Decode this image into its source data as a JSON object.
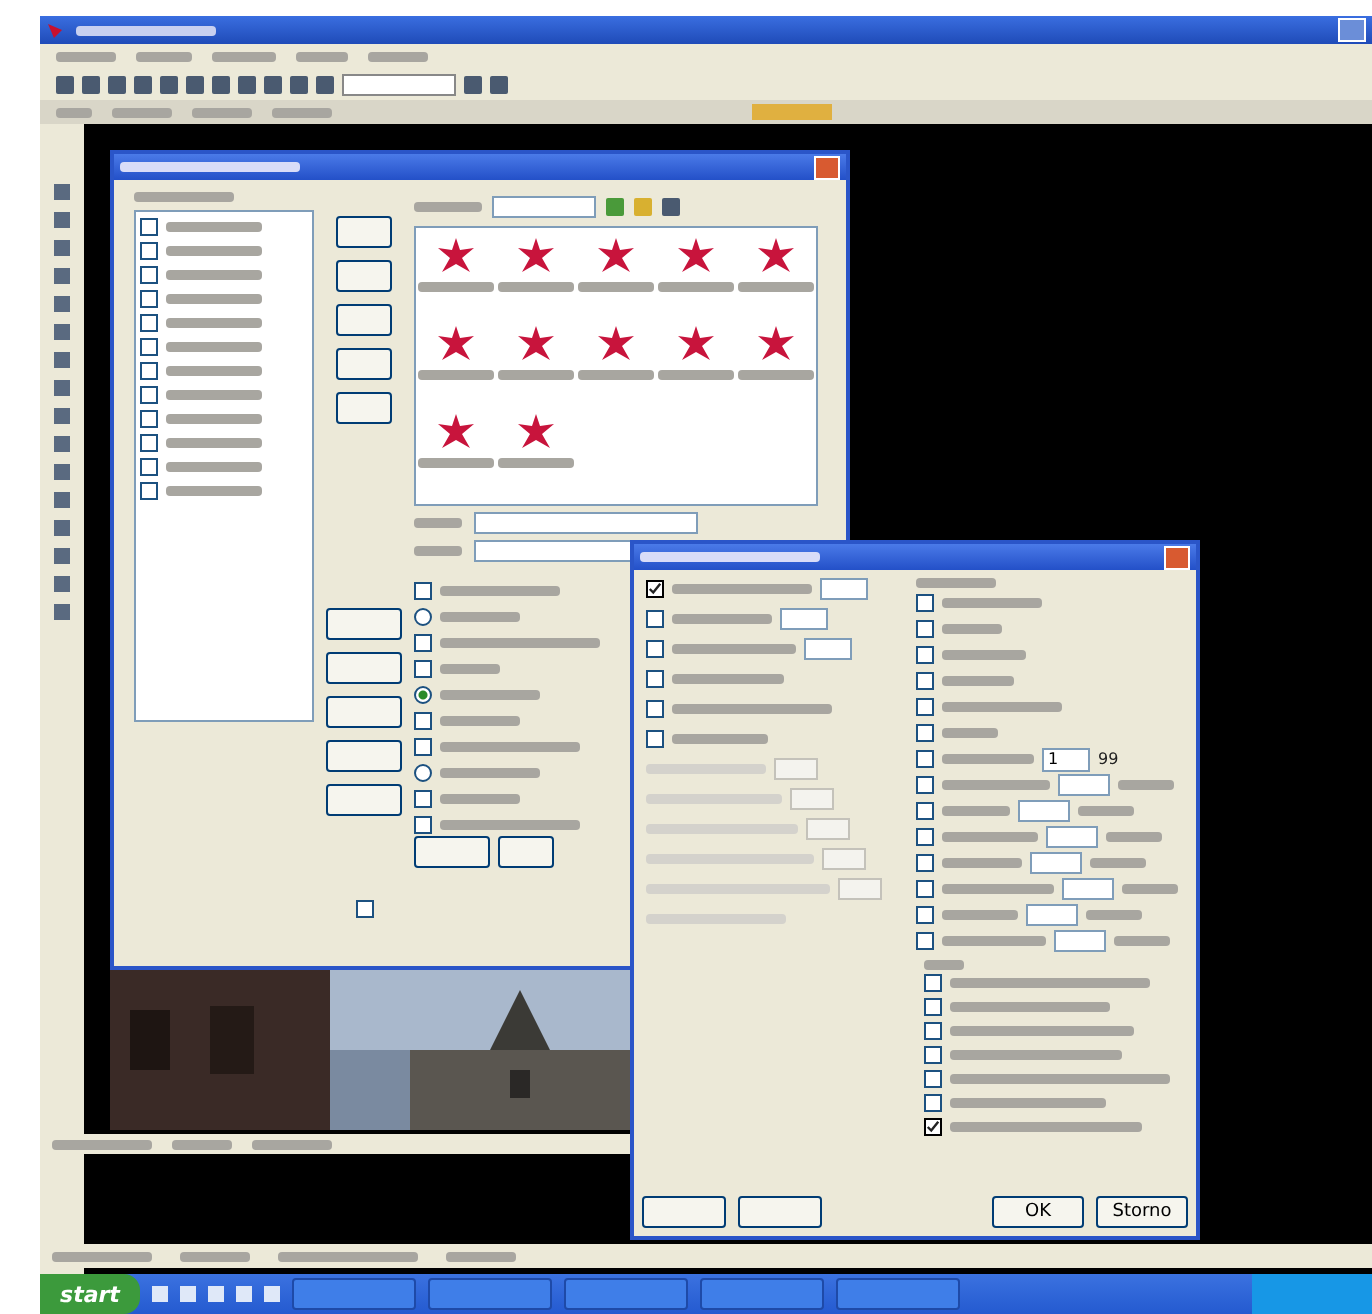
{
  "file_list": {
    "items": [
      {
        "checked": false
      },
      {
        "checked": false
      },
      {
        "checked": false
      },
      {
        "checked": false
      },
      {
        "checked": false
      },
      {
        "checked": false
      },
      {
        "checked": false
      },
      {
        "checked": false
      },
      {
        "checked": false
      },
      {
        "checked": false
      },
      {
        "checked": false
      },
      {
        "checked": false
      }
    ]
  },
  "view_options": [
    {
      "kind": "checkbox",
      "checked": false
    },
    {
      "kind": "radio",
      "checked": false
    },
    {
      "kind": "checkbox",
      "checked": false
    },
    {
      "kind": "checkbox",
      "checked": false
    },
    {
      "kind": "radio",
      "checked": true
    },
    {
      "kind": "checkbox",
      "checked": false
    },
    {
      "kind": "checkbox",
      "checked": false
    },
    {
      "kind": "radio",
      "checked": false
    },
    {
      "kind": "checkbox",
      "checked": false
    },
    {
      "kind": "checkbox",
      "checked": false
    }
  ],
  "side_option": {
    "checked": false
  },
  "filter_dialog": {
    "left_options": [
      {
        "checked": true
      },
      {
        "checked": false
      },
      {
        "checked": false
      },
      {
        "checked": false
      },
      {
        "checked": false
      },
      {
        "checked": false
      }
    ],
    "right_options": [
      {
        "checked": false
      },
      {
        "checked": false
      },
      {
        "checked": false
      },
      {
        "checked": false
      },
      {
        "checked": false
      },
      {
        "checked": false
      },
      {
        "checked": false
      },
      {
        "checked": false
      },
      {
        "checked": false
      },
      {
        "checked": false
      },
      {
        "checked": false
      },
      {
        "checked": false
      },
      {
        "checked": false
      },
      {
        "checked": false
      }
    ],
    "spin_value": "1",
    "spin_max": "99",
    "lower_options": [
      {
        "checked": false
      },
      {
        "checked": false
      },
      {
        "checked": false
      },
      {
        "checked": false
      },
      {
        "checked": false
      },
      {
        "checked": false
      },
      {
        "checked": true
      }
    ],
    "buttons": [
      "OK",
      "Storno"
    ]
  },
  "taskbar": {
    "start": "start"
  }
}
